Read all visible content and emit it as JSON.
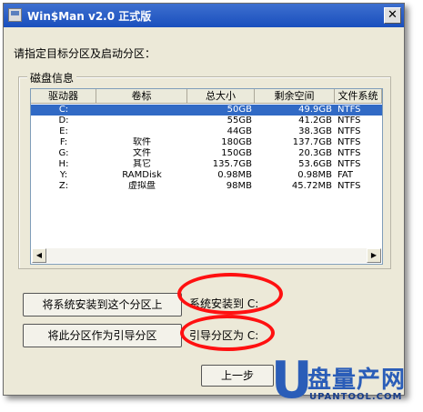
{
  "window": {
    "title": "Win$Man v2.0 正式版",
    "close_glyph": "✕"
  },
  "prompt": "请指定目标分区及启动分区：",
  "disk_group": {
    "label": "磁盘信息"
  },
  "table": {
    "columns": [
      "驱动器",
      "卷标",
      "总大小",
      "剩余空间",
      "文件系统"
    ],
    "rows": [
      {
        "drive": "C:",
        "label": "",
        "total": "50GB",
        "free": "49.9GB",
        "fs": "NTFS",
        "selected": true
      },
      {
        "drive": "D:",
        "label": "",
        "total": "55GB",
        "free": "41.2GB",
        "fs": "NTFS"
      },
      {
        "drive": "E:",
        "label": "",
        "total": "44GB",
        "free": "38.3GB",
        "fs": "NTFS"
      },
      {
        "drive": "F:",
        "label": "软件",
        "total": "180GB",
        "free": "137.7GB",
        "fs": "NTFS"
      },
      {
        "drive": "G:",
        "label": "文件",
        "total": "150GB",
        "free": "20.3GB",
        "fs": "NTFS"
      },
      {
        "drive": "H:",
        "label": "其它",
        "total": "135.7GB",
        "free": "53.6GB",
        "fs": "NTFS"
      },
      {
        "drive": "Y:",
        "label": "RAMDisk",
        "total": "0.98MB",
        "free": "0.98MB",
        "fs": "FAT"
      },
      {
        "drive": "Z:",
        "label": "虚拟盘",
        "total": "98MB",
        "free": "45.72MB",
        "fs": "NTFS"
      }
    ]
  },
  "scrollbar": {
    "left_glyph": "◀",
    "right_glyph": "▶"
  },
  "actions": {
    "install_button": "将系统安装到这个分区上",
    "install_info": "系统安装到  C:",
    "boot_button": "将此分区作为引导分区",
    "boot_info": "引导分区为  C:",
    "back_button": "上一步"
  },
  "watermark": {
    "letter": "U",
    "text": "盘量产网",
    "url": "UPANTOOL.COM"
  },
  "colors": {
    "selection": "#316ac5",
    "annotation": "#ff1010",
    "watermark": "#2a5db8"
  }
}
